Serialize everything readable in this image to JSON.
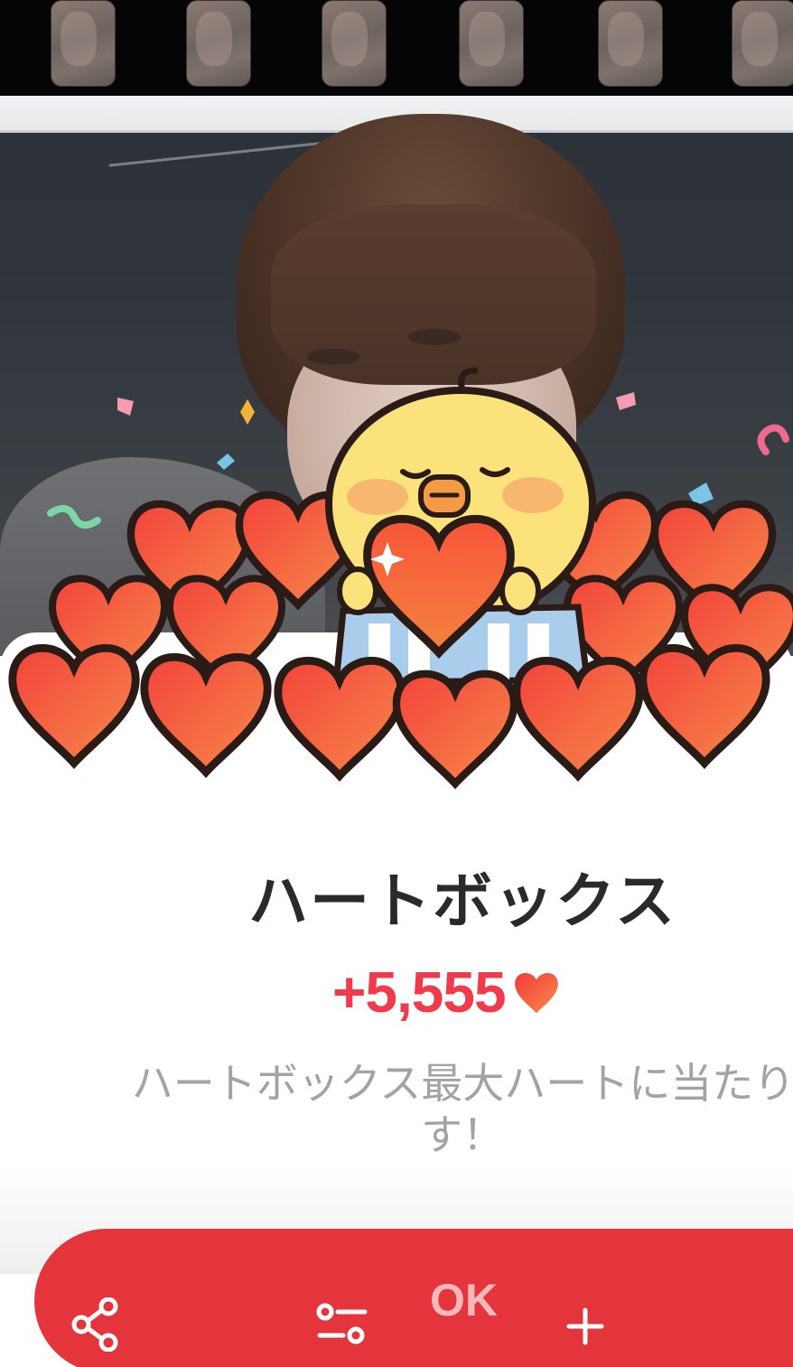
{
  "thumbnails": [
    {
      "name": "thumb-1"
    },
    {
      "name": "thumb-2"
    },
    {
      "name": "thumb-3"
    },
    {
      "name": "thumb-4"
    },
    {
      "name": "thumb-5"
    },
    {
      "name": "thumb-6"
    }
  ],
  "reward": {
    "title": "ハートボックス",
    "amount": "+5,555",
    "description_line1": "ハートボックス最大ハートに当たり",
    "description_line2": "す！"
  },
  "action_bar": {
    "ok_label": "OK",
    "share_icon": "share-icon",
    "settings_icon": "settings-sliders-icon",
    "add_icon": "plus-icon"
  },
  "colors": {
    "accent_red": "#ef3b4b",
    "bar_red": "#e4353c",
    "heart_orange": "#f46a3a",
    "chick_yellow": "#fbe27a"
  }
}
